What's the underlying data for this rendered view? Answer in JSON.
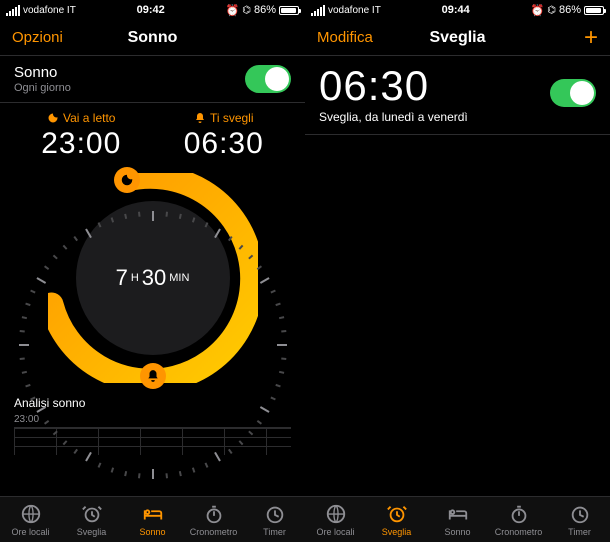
{
  "left": {
    "status": {
      "carrier": "vodafone IT",
      "time": "09:42",
      "battery_pct": "86%"
    },
    "nav": {
      "left": "Opzioni",
      "title": "Sonno"
    },
    "sleep_row": {
      "title": "Sonno",
      "subtitle": "Ogni giorno"
    },
    "bedtime": {
      "label": "Vai a letto",
      "time": "23:00"
    },
    "wake": {
      "label": "Ti svegli",
      "time": "06:30"
    },
    "duration": {
      "hours": "7",
      "h_unit": "H",
      "mins": "30",
      "m_unit": "MIN"
    },
    "analysis": {
      "title": "Analisi sonno",
      "start": "23:00"
    },
    "tabs": [
      "Ore locali",
      "Sveglia",
      "Sonno",
      "Cronometro",
      "Timer"
    ],
    "active_tab": 2
  },
  "right": {
    "status": {
      "carrier": "vodafone IT",
      "time": "09:44",
      "battery_pct": "86%"
    },
    "nav": {
      "left": "Modifica",
      "title": "Sveglia"
    },
    "alarm": {
      "time": "06:30",
      "subtitle": "Sveglia, da lunedì a venerdì"
    },
    "tabs": [
      "Ore locali",
      "Sveglia",
      "Sonno",
      "Cronometro",
      "Timer"
    ],
    "active_tab": 1
  }
}
